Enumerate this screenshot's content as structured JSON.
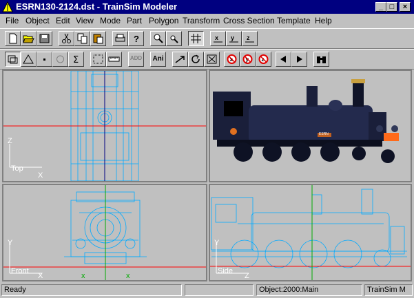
{
  "window": {
    "title": "ESRN130-2124.dst - TrainSim Modeler",
    "minimize_glyph": "_",
    "maximize_glyph": "□",
    "close_glyph": "×"
  },
  "menubar": {
    "items": [
      "File",
      "Object",
      "Edit",
      "View",
      "Mode",
      "Part",
      "Polygon",
      "Transform",
      "Cross Section",
      "Template",
      "Help"
    ]
  },
  "toolbar2": {
    "ani_label": "Ani",
    "add_label": "ADD"
  },
  "viewports": {
    "top": {
      "label": "Top",
      "axis_v": "Z",
      "axis_h": "X"
    },
    "front": {
      "label": "Front",
      "axis_v": "Y",
      "axis_h": "X"
    },
    "side": {
      "label": "Side",
      "axis_v": "Y",
      "axis_h": "Z"
    },
    "perspective": {
      "plate_text": "ESRN"
    }
  },
  "statusbar": {
    "status": "Ready",
    "object": "Object:2000:Main",
    "app": "TrainSim M"
  },
  "colors": {
    "wire": "#00aaff",
    "axis_red": "#ff0000",
    "axis_green": "#00aa00",
    "title_bg": "#000080"
  }
}
